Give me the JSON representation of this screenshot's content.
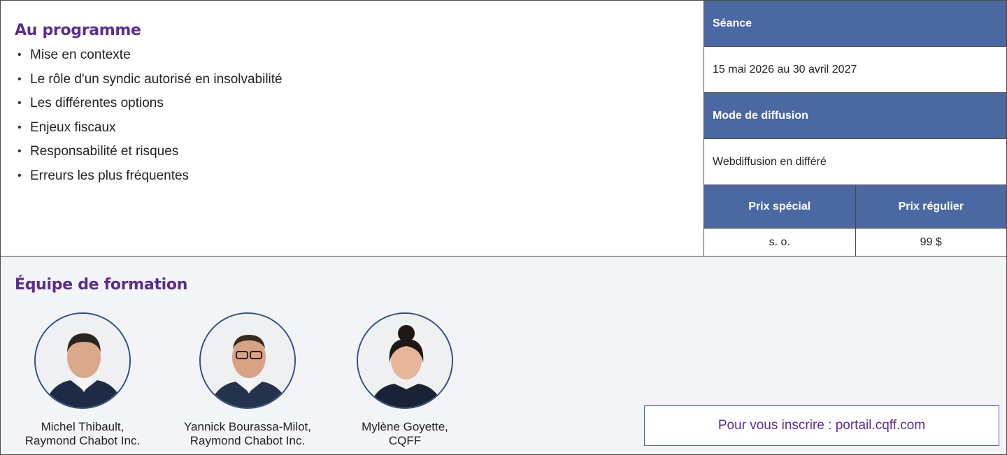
{
  "program": {
    "title": "Au programme",
    "items": [
      "Mise en contexte",
      "Le rôle d'un syndic autorisé en insolvabilité",
      "Les différentes options",
      "Enjeux fiscaux",
      "Responsabilité et risques",
      "Erreurs les plus fréquentes"
    ]
  },
  "session": {
    "header": "Séance",
    "value": "15 mai 2026 au 30 avril 2027",
    "mode_header": "Mode de diffusion",
    "mode_value": "Webdiffusion en différé",
    "special_price_label": "Prix spécial",
    "regular_price_label": "Prix régulier",
    "special_price": "s. o.",
    "regular_price": "99 $"
  },
  "team": {
    "title": "Équipe de formation",
    "members": [
      {
        "name": "Michel Thibault,",
        "org": "Raymond Chabot Inc."
      },
      {
        "name": "Yannick Bourassa-Milot,",
        "org": "Raymond Chabot Inc."
      },
      {
        "name": "Mylène Goyette,",
        "org": "CQFF"
      }
    ]
  },
  "cta": {
    "label": "Pour vous inscrire : portail.cqff.com"
  },
  "colors": {
    "accent": "#5b2d8e",
    "header_bg": "#4b68a3",
    "team_bg": "#f2f4f7"
  }
}
